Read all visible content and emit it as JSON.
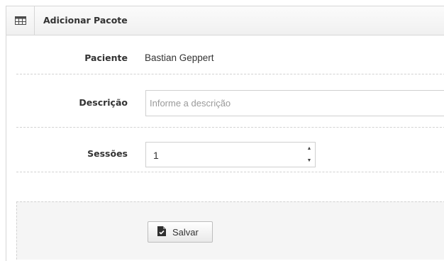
{
  "panel": {
    "title": "Adicionar Pacote",
    "icon": "table-icon"
  },
  "form": {
    "patient": {
      "label": "Paciente",
      "value": "Bastian Geppert"
    },
    "description": {
      "label": "Descrição",
      "placeholder": "Informe a descrição",
      "value": ""
    },
    "sessions": {
      "label": "Sessões",
      "value": "1"
    }
  },
  "actions": {
    "save_label": "Salvar",
    "save_icon": "save-file-icon"
  },
  "colors": {
    "border": "#d6d6d6",
    "header_bg": "#f4f4f4",
    "actions_bg": "#f5f5f5",
    "text": "#333333",
    "placeholder": "#9a9a9a"
  }
}
